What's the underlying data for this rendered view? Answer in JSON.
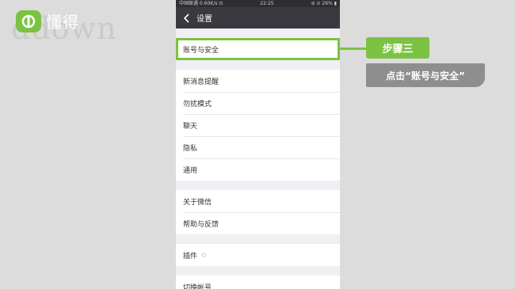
{
  "brand": {
    "name": "懂得",
    "watermark": "ddown"
  },
  "statusbar": {
    "left": "中国联通 0.60K/s ⊡",
    "time": "22:25",
    "right": "⊘ ⊙ 26% ▮"
  },
  "titlebar": {
    "title": "设置"
  },
  "settings": {
    "account_security": "账号与安全",
    "group1": [
      "新消息提醒",
      "勿扰模式",
      "聊天",
      "隐私",
      "通用"
    ],
    "group2": [
      "关于微信",
      "帮助与反馈"
    ],
    "plugins": "插件",
    "switch_account": "切换帐号"
  },
  "callout": {
    "step": "步骤三",
    "instruction": "点击“账号与安全”"
  },
  "colors": {
    "accent": "#7cc242",
    "titlebar": "#393a3f",
    "callout_gray": "#8e8e8e"
  }
}
